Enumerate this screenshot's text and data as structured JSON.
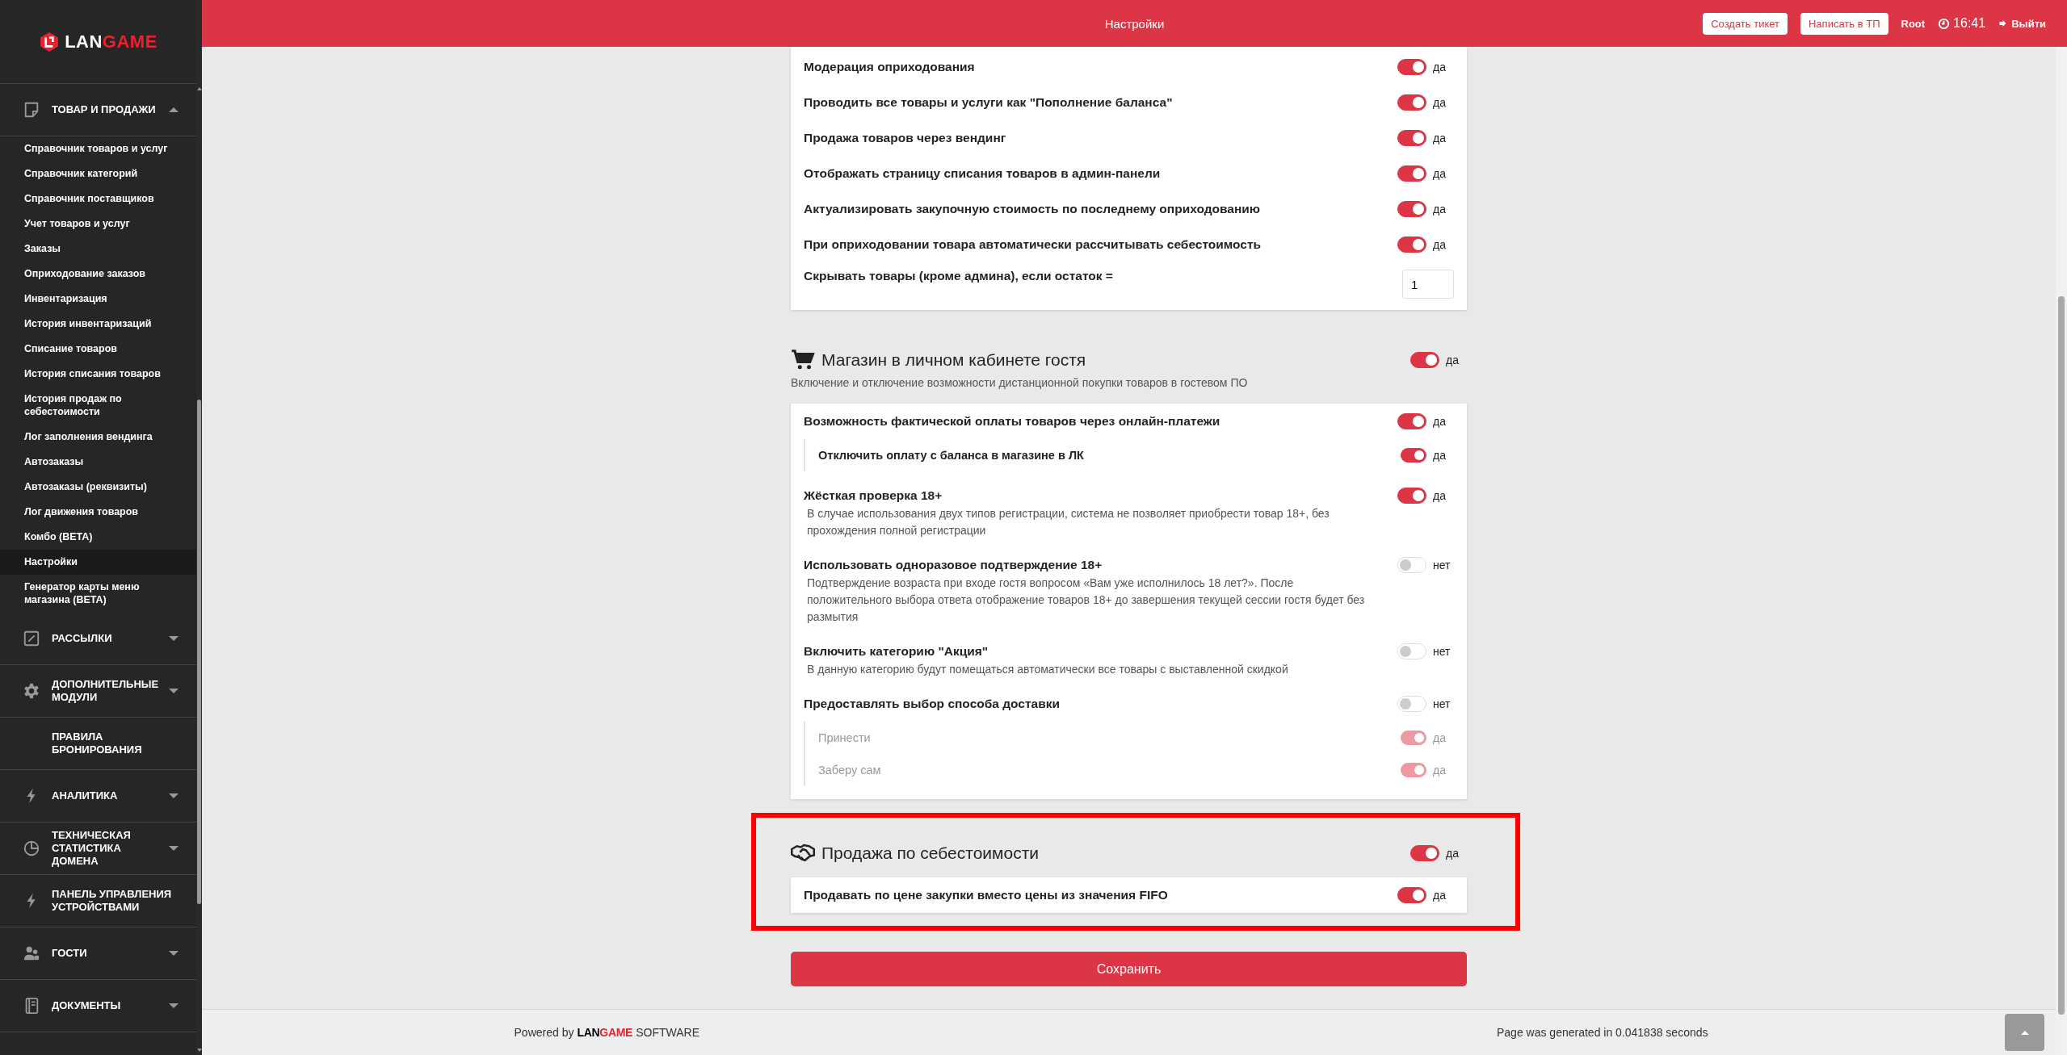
{
  "sidebar": {
    "logo": {
      "part_1": "LAN",
      "part_2": "GAME"
    },
    "groups": [
      {
        "label": "ТОВАР И ПРОДАЖИ",
        "kind": "group",
        "expanded": true,
        "children": [
          {
            "label": "Справочник товаров и услуг",
            "selected": false
          },
          {
            "label": "Справочник категорий",
            "selected": false
          },
          {
            "label": "Справочник поставщиков",
            "selected": false
          },
          {
            "label": "Учет товаров и услуг",
            "selected": false
          },
          {
            "label": "Заказы",
            "selected": false
          },
          {
            "label": "Оприходование заказов",
            "selected": false
          },
          {
            "label": "Инвентаризация",
            "selected": false
          },
          {
            "label": "История инвентаризаций",
            "selected": false
          },
          {
            "label": "Списание товаров",
            "selected": false
          },
          {
            "label": "История списания товаров",
            "selected": false
          },
          {
            "label": "История продаж по себестоимости",
            "selected": false
          },
          {
            "label": "Лог заполнения вендинга",
            "selected": false
          },
          {
            "label": "Автозаказы",
            "selected": false
          },
          {
            "label": "Автозаказы (реквизиты)",
            "selected": false
          },
          {
            "label": "Лог движения товаров",
            "selected": false
          },
          {
            "label": "Комбо (BETA)",
            "selected": false
          },
          {
            "label": "Настройки",
            "selected": true
          },
          {
            "label": "Генератор карты меню магазина (BETA)",
            "selected": false
          }
        ]
      },
      {
        "label": "РАССЫЛКИ",
        "kind": "group",
        "expanded": false
      },
      {
        "label": "ДОПОЛНИТЕЛЬНЫЕ МОДУЛИ",
        "kind": "group",
        "expanded": false
      },
      {
        "label": "ПРАВИЛА БРОНИРОВАНИЯ",
        "kind": "link"
      },
      {
        "label": "АНАЛИТИКА",
        "kind": "group",
        "expanded": false
      },
      {
        "label": "ТЕХНИЧЕСКАЯ СТАТИСТИКА ДОМЕНА",
        "kind": "group",
        "expanded": false
      },
      {
        "label": "ПАНЕЛЬ УПРАВЛЕНИЯ УСТРОЙСТВАМИ",
        "kind": "link"
      },
      {
        "label": "ГОСТИ",
        "kind": "group",
        "expanded": false
      },
      {
        "label": "ДОКУМЕНТЫ",
        "kind": "group",
        "expanded": false
      }
    ]
  },
  "top_bar": {
    "title": "Настройки",
    "buttons": [
      "Создать тикет",
      "Написать в ТП"
    ],
    "user": "Root",
    "time": "16:41",
    "logout": "Выйти"
  },
  "settings": {
    "sections": [
      {
        "rows": [
          {
            "kind": "toggle",
            "label": "Модерация оприходования",
            "on": true,
            "state": "да"
          },
          {
            "kind": "toggle",
            "label": "Проводить все товары и услуги как \"Пополнение баланса\"",
            "on": true,
            "state": "да"
          },
          {
            "kind": "toggle",
            "label": "Продажа товаров через вендинг",
            "on": true,
            "state": "да"
          },
          {
            "kind": "toggle",
            "label": "Отображать страницу списания товаров в админ-панели",
            "on": true,
            "state": "да"
          },
          {
            "kind": "toggle",
            "label": "Актуализировать закупочную стоимость по последнему оприходованию",
            "on": true,
            "state": "да"
          },
          {
            "kind": "toggle",
            "label": "При оприходовании товара автоматически рассчитывать себестоимость",
            "on": true,
            "state": "да"
          },
          {
            "kind": "number",
            "label": "Скрывать товары (кроме админа), если остаток =",
            "value": "1"
          }
        ]
      },
      {
        "title": "Магазин в личном кабинете гостя",
        "subtitle": "Включение и отключение возможности дистанционной покупки товаров в гостевом ПО",
        "on": true,
        "state": "да",
        "highlighted": false,
        "rows": [
          {
            "kind": "toggle",
            "label": "Возможность фактической оплаты товаров через онлайн-платежи",
            "on": true,
            "state": "да",
            "children": [
              {
                "label": "Отключить оплату с баланса в магазине в ЛК",
                "on": true,
                "state": "да",
                "disabled": false
              }
            ]
          },
          {
            "kind": "toggle",
            "label": "Жёсткая проверка 18+",
            "on": true,
            "state": "да",
            "description": "В случае использования двух типов регистрации, система не позволяет приобрести товар 18+, без прохождения полной регистрации"
          },
          {
            "kind": "toggle",
            "label": "Использовать одноразовое подтверждение 18+",
            "on": false,
            "state": "нет",
            "description": "Подтверждение возраста при входе гостя вопросом «Вам уже исполнилось 18 лет?». После положительного выбора ответа отображение товаров 18+ до завершения текущей сессии гостя будет без размытия"
          },
          {
            "kind": "toggle",
            "label": "Включить категорию \"Акция\"",
            "on": false,
            "state": "нет",
            "description": "В данную категорию будут помещаться автоматически все товары с выставленной скидкой"
          },
          {
            "kind": "toggle",
            "label": "Предоставлять выбор способа доставки",
            "on": false,
            "state": "нет",
            "children": [
              {
                "label": "Принести",
                "on": true,
                "state": "да",
                "disabled": true
              },
              {
                "label": "Заберу сам",
                "on": true,
                "state": "да",
                "disabled": true
              }
            ]
          }
        ]
      },
      {
        "title": "Продажа по себестоимости",
        "on": true,
        "state": "да",
        "highlighted": true,
        "rows": [
          {
            "kind": "toggle",
            "label": "Продавать по цене закупки вместо цены из значения FIFO",
            "on": true,
            "state": "да"
          }
        ]
      }
    ],
    "save_button": "Сохранить"
  },
  "footer": {
    "powered_by": "Powered by",
    "logo": {
      "part_1": "LAN",
      "part_2": "GAME"
    },
    "software": "SOFTWARE",
    "generated": "Page was generated in 0.041838 seconds"
  }
}
